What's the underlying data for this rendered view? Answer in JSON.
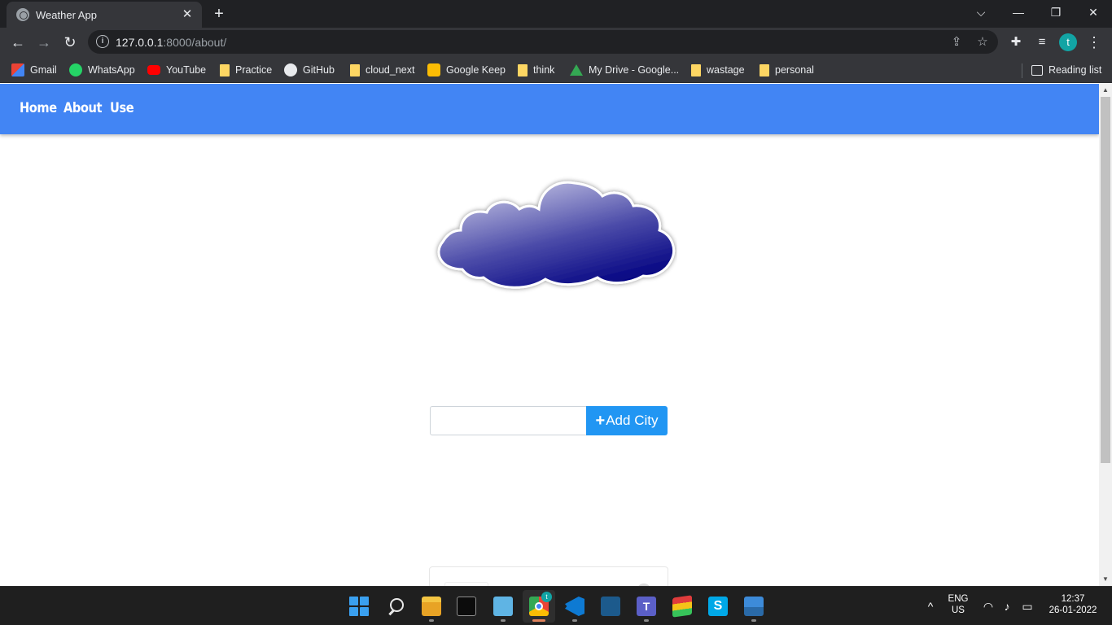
{
  "browser": {
    "tab_title": "Weather App",
    "tab_close": "✕",
    "new_tab": "+",
    "window_controls": {
      "tabsearch": "⌵",
      "minimize": "—",
      "restore": "❐",
      "close": "✕"
    },
    "nav": {
      "back": "←",
      "forward": "→",
      "reload": "↻"
    },
    "url_host": "127.0.0.1",
    "url_rest": ":8000/about/",
    "toolbar_icons": {
      "share": "⇪",
      "star": "☆",
      "extensions": "✚",
      "media": "≡",
      "menu": "⋮"
    },
    "profile_initial": "t",
    "bookmarks": [
      {
        "label": "Gmail",
        "icon": "gmail-icon"
      },
      {
        "label": "WhatsApp",
        "icon": "whatsapp-icon"
      },
      {
        "label": "YouTube",
        "icon": "youtube-icon"
      },
      {
        "label": "Practice",
        "icon": "folder-icon"
      },
      {
        "label": "GitHub",
        "icon": "github-icon"
      },
      {
        "label": "cloud_next",
        "icon": "folder-icon"
      },
      {
        "label": "Google Keep",
        "icon": "keep-icon"
      },
      {
        "label": "think",
        "icon": "folder-icon"
      },
      {
        "label": "My Drive - Google...",
        "icon": "drive-icon"
      },
      {
        "label": "wastage",
        "icon": "folder-icon"
      },
      {
        "label": "personal",
        "icon": "folder-icon"
      }
    ],
    "reading_list": "Reading list"
  },
  "page": {
    "nav_links": [
      "Home",
      "About",
      "Use"
    ],
    "city_input_placeholder": "",
    "add_button_icon": "+",
    "add_button_label": "Add City",
    "colors": {
      "navbar": "#4285f4",
      "button": "#2196f3",
      "cloud_dark": "#000080",
      "cloud_light": "#c8c8e6"
    }
  },
  "scrollbar": {
    "up": "▲",
    "down": "▼"
  },
  "taskbar": {
    "apps": [
      {
        "name": "start-button",
        "icon": "windows-start-icon"
      },
      {
        "name": "search-button",
        "icon": "search-icon"
      },
      {
        "name": "file-explorer",
        "icon": "folder-icon"
      },
      {
        "name": "terminal",
        "icon": "terminal-icon"
      },
      {
        "name": "notepad",
        "icon": "notepad-icon"
      },
      {
        "name": "chrome",
        "icon": "chrome-icon"
      },
      {
        "name": "vscode",
        "icon": "vscode-icon"
      },
      {
        "name": "mysql-workbench",
        "icon": "mysql-icon"
      },
      {
        "name": "teams",
        "icon": "teams-icon"
      },
      {
        "name": "bluestacks",
        "icon": "bluestacks-icon"
      },
      {
        "name": "skype",
        "icon": "skype-icon"
      },
      {
        "name": "photos",
        "icon": "photos-icon"
      }
    ],
    "chrome_badge": "t",
    "skype_letter": "S",
    "teams_letter": "T",
    "tray": {
      "chevron": "^",
      "lang_top": "ENG",
      "lang_bottom": "US",
      "time": "12:37",
      "date": "26-01-2022"
    }
  }
}
